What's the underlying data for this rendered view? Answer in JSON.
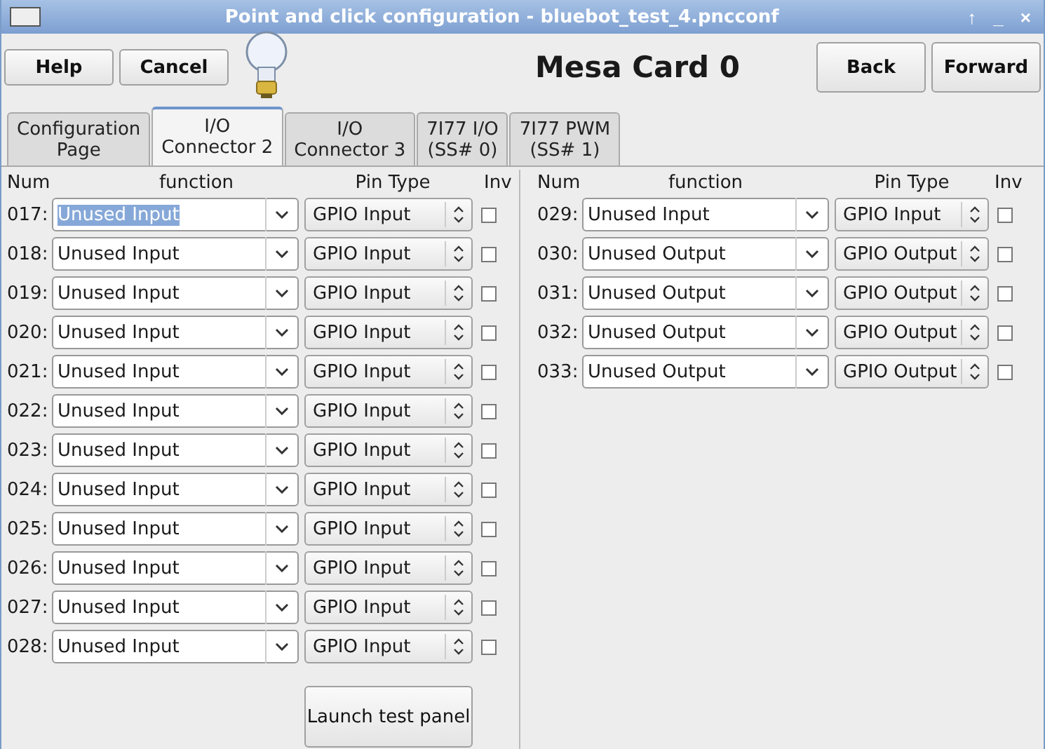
{
  "window": {
    "title": "Point and click configuration - bluebot_test_4.pncconf",
    "controls": [
      "↑",
      "_",
      "×"
    ]
  },
  "toolbar": {
    "left_buttons": [
      "Help",
      "Cancel"
    ],
    "heading": "Mesa Card 0",
    "right_buttons": [
      "Back",
      "Forward"
    ]
  },
  "tabs": [
    {
      "label": "Configuration\nPage",
      "selected": false
    },
    {
      "label": "I/O\nConnector 2",
      "selected": true
    },
    {
      "label": "I/O\nConnector 3",
      "selected": false
    },
    {
      "label": "7I77 I/O\n(SS# 0)",
      "selected": false
    },
    {
      "label": "7I77 PWM\n(SS# 1)",
      "selected": false
    }
  ],
  "columns": [
    "Num",
    "function",
    "Pin Type",
    "Inv"
  ],
  "left_pins": [
    {
      "num": "017:",
      "function": "Unused Input",
      "text_selected": true,
      "pin_type": "GPIO Input",
      "inv": false
    },
    {
      "num": "018:",
      "function": "Unused Input",
      "text_selected": false,
      "pin_type": "GPIO Input",
      "inv": false
    },
    {
      "num": "019:",
      "function": "Unused Input",
      "text_selected": false,
      "pin_type": "GPIO Input",
      "inv": false
    },
    {
      "num": "020:",
      "function": "Unused Input",
      "text_selected": false,
      "pin_type": "GPIO Input",
      "inv": false
    },
    {
      "num": "021:",
      "function": "Unused Input",
      "text_selected": false,
      "pin_type": "GPIO Input",
      "inv": false
    },
    {
      "num": "022:",
      "function": "Unused Input",
      "text_selected": false,
      "pin_type": "GPIO Input",
      "inv": false
    },
    {
      "num": "023:",
      "function": "Unused Input",
      "text_selected": false,
      "pin_type": "GPIO Input",
      "inv": false
    },
    {
      "num": "024:",
      "function": "Unused Input",
      "text_selected": false,
      "pin_type": "GPIO Input",
      "inv": false
    },
    {
      "num": "025:",
      "function": "Unused Input",
      "text_selected": false,
      "pin_type": "GPIO Input",
      "inv": false
    },
    {
      "num": "026:",
      "function": "Unused Input",
      "text_selected": false,
      "pin_type": "GPIO Input",
      "inv": false
    },
    {
      "num": "027:",
      "function": "Unused Input",
      "text_selected": false,
      "pin_type": "GPIO Input",
      "inv": false
    },
    {
      "num": "028:",
      "function": "Unused Input",
      "text_selected": false,
      "pin_type": "GPIO Input",
      "inv": false
    }
  ],
  "right_columns": [
    "Num",
    "function",
    "Pin Type",
    "Inv"
  ],
  "right_pins": [
    {
      "num": "029:",
      "function": "Unused Input",
      "text_selected": false,
      "pin_type": "GPIO Input",
      "inv": false
    },
    {
      "num": "030:",
      "function": "Unused Output",
      "text_selected": false,
      "pin_type": "GPIO Output",
      "inv": false
    },
    {
      "num": "031:",
      "function": "Unused Output",
      "text_selected": false,
      "pin_type": "GPIO Output",
      "inv": false
    },
    {
      "num": "032:",
      "function": "Unused Output",
      "text_selected": false,
      "pin_type": "GPIO Output",
      "inv": false
    },
    {
      "num": "033:",
      "function": "Unused Output",
      "text_selected": false,
      "pin_type": "GPIO Output",
      "inv": false
    }
  ],
  "launch_button": "Launch test panel"
}
